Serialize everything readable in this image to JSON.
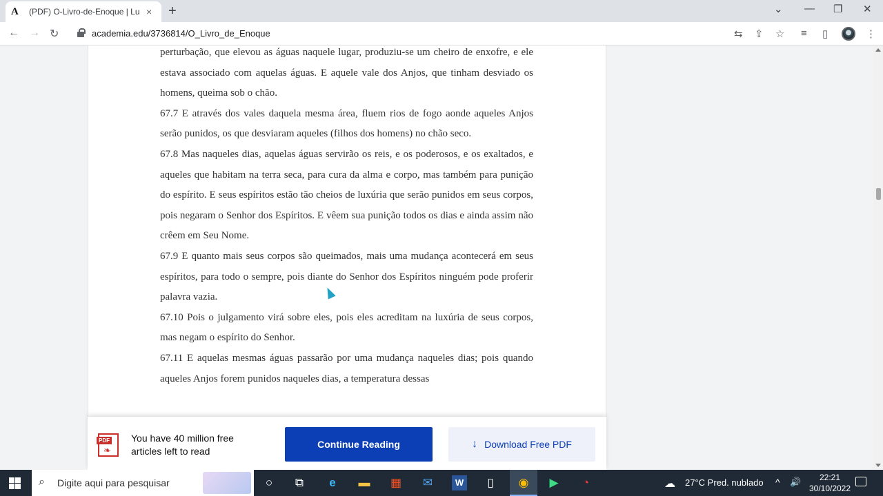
{
  "browser": {
    "tab_title": "(PDF) O-Livro-de-Enoque | Lucin",
    "tab_favicon": "A",
    "tab_close": "×",
    "new_tab": "+",
    "url": "academia.edu/3736814/O_Livro_de_Enoque",
    "icons": {
      "back": "←",
      "forward": "→",
      "reload": "↻",
      "translate": "⇆",
      "share": "⇪",
      "bookmark": "☆",
      "reading_list": "≡",
      "side_panel": "▯",
      "menu": "⋮",
      "minimize": "—",
      "restore": "❐",
      "close": "✕",
      "tab_search": "⌄"
    }
  },
  "document": {
    "paragraphs": [
      "perturbação, que elevou as águas naquele lugar, produziu-se um cheiro de enxofre, e ele estava associado com aquelas águas. E aquele vale dos Anjos, que tinham desviado os homens, queima sob o chão.",
      "67.7 E através dos vales daquela mesma área, fluem rios de fogo aonde aqueles Anjos serão punidos, os que desviaram aqueles (filhos dos homens) no chão seco.",
      "67.8 Mas naqueles dias, aquelas águas servirão os reis, e os poderosos, e os exaltados, e aqueles que habitam na terra seca, para cura da alma e corpo, mas também para punição do espírito. E seus espíritos estão tão cheios de luxúria que serão punidos em seus corpos, pois negaram o Senhor dos Espíritos. E vêem sua punição todos os dias e ainda assim não crêem em Seu Nome.",
      "67.9 E quanto mais seus corpos são queimados, mais uma mudança acontecerá em seus espíritos, para todo o sempre, pois diante do Senhor dos Espíritos ninguém pode proferir palavra vazia.",
      "67.10 Pois o julgamento virá sobre eles, pois eles acreditam na luxúria de seus corpos, mas negam o espírito do Senhor.",
      "67.11 E aquelas mesmas águas passarão por uma mudança naqueles dias; pois quando aqueles Anjos forem punidos naqueles dias, a temperatura dessas"
    ]
  },
  "banner": {
    "pdf_tag": "PDF",
    "message": "You have 40 million free articles left to read",
    "continue_label": "Continue Reading",
    "download_label": "Download Free PDF",
    "download_icon": "↓"
  },
  "taskbar": {
    "search_placeholder": "Digite aqui para pesquisar",
    "search_icon": "⌕",
    "apps": {
      "cortana": "○",
      "task_view": "⧉",
      "edge": "e",
      "explorer": "▬",
      "store": "▦",
      "mail": "✉",
      "word": "W",
      "file": "▯",
      "chrome": "◉",
      "app": "▶",
      "clock_app": "◔"
    },
    "weather_icon": "☁",
    "weather": "27°C  Pred. nublado",
    "tray_up": "^",
    "tray_volume": "🔊",
    "time": "22:21",
    "date": "30/10/2022"
  },
  "colors": {
    "primary_button": "#0c3eb5",
    "download_bg": "#eef1fa",
    "taskbar": "#1f2a36"
  }
}
